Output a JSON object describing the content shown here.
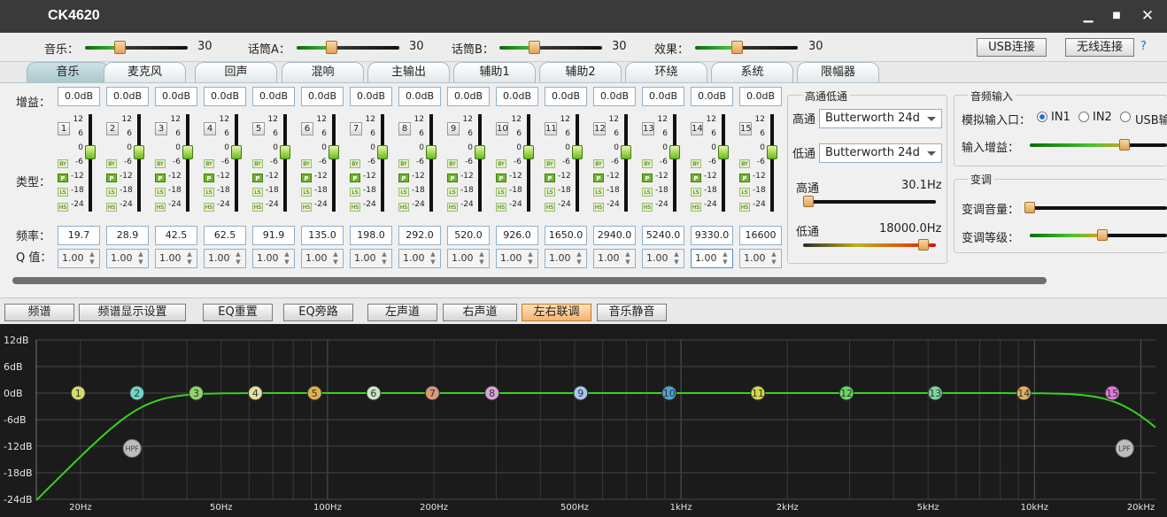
{
  "title": "CK4620",
  "window": {
    "minimize": "▁",
    "maximize": "■",
    "close": "✕"
  },
  "volumes": [
    {
      "label": "音乐：",
      "value": "30"
    },
    {
      "label": "话筒A：",
      "value": "30"
    },
    {
      "label": "话筒B：",
      "value": "30"
    },
    {
      "label": "效果：",
      "value": "30"
    }
  ],
  "buttons": {
    "usb": "USB连接",
    "wireless": "无线连接",
    "help": "?"
  },
  "tabs": [
    "音乐",
    "麦克风",
    "回声",
    "混响",
    "主输出",
    "辅助1",
    "辅助2",
    "环绕",
    "系统",
    "限幅器"
  ],
  "active_tab": 0,
  "labels": {
    "gain": "增益：",
    "type": "类型：",
    "freq": "频率：",
    "q": "Q 值："
  },
  "scale": [
    "12",
    "6",
    "0",
    "-6",
    "-12",
    "-18",
    "-24"
  ],
  "badges": [
    "BY",
    "P",
    "LS",
    "HS"
  ],
  "channels": [
    {
      "num": "1",
      "gain": "0.0dB",
      "freq": "19.7",
      "q": "1.00"
    },
    {
      "num": "2",
      "gain": "0.0dB",
      "freq": "28.9",
      "q": "1.00"
    },
    {
      "num": "3",
      "gain": "0.0dB",
      "freq": "42.5",
      "q": "1.00"
    },
    {
      "num": "4",
      "gain": "0.0dB",
      "freq": "62.5",
      "q": "1.00"
    },
    {
      "num": "5",
      "gain": "0.0dB",
      "freq": "91.9",
      "q": "1.00"
    },
    {
      "num": "6",
      "gain": "0.0dB",
      "freq": "135.0",
      "q": "1.00"
    },
    {
      "num": "7",
      "gain": "0.0dB",
      "freq": "198.0",
      "q": "1.00"
    },
    {
      "num": "8",
      "gain": "0.0dB",
      "freq": "292.0",
      "q": "1.00"
    },
    {
      "num": "9",
      "gain": "0.0dB",
      "freq": "520.0",
      "q": "1.00"
    },
    {
      "num": "10",
      "gain": "0.0dB",
      "freq": "926.0",
      "q": "1.00"
    },
    {
      "num": "11",
      "gain": "0.0dB",
      "freq": "1650.0",
      "q": "1.00"
    },
    {
      "num": "12",
      "gain": "0.0dB",
      "freq": "2940.0",
      "q": "1.00"
    },
    {
      "num": "13",
      "gain": "0.0dB",
      "freq": "5240.0",
      "q": "1.00"
    },
    {
      "num": "14",
      "gain": "0.0dB",
      "freq": "9330.0",
      "q": "1.00"
    },
    {
      "num": "15",
      "gain": "0.0dB",
      "freq": "16600",
      "q": "1.00"
    }
  ],
  "selected_q_channel": 13,
  "hplp": {
    "title": "高通低通",
    "hp_label": "高通",
    "hp_type": "Butterworth 24d",
    "lp_label": "低通",
    "lp_type": "Butterworth 24d",
    "hp_slider_label": "高通",
    "hp_value": "30.1Hz",
    "lp_slider_label": "低通",
    "lp_value": "18000.0Hz"
  },
  "audio_input": {
    "title": "音频输入",
    "port_label": "模拟输入口：",
    "options": [
      "IN1",
      "IN2",
      "USB输"
    ],
    "selected": 0,
    "gain_label": "输入增益："
  },
  "pitch": {
    "title": "变调",
    "volume_label": "变调音量：",
    "level_label": "变调等级："
  },
  "toolbar": [
    "频谱",
    "频谱显示设置",
    "EQ重置",
    "EQ旁路",
    "左声道",
    "右声道",
    "左右联调",
    "音乐静音"
  ],
  "toolbar_active": 6,
  "graph": {
    "y_labels": [
      "12dB",
      "6dB",
      "0dB",
      "-6dB",
      "-12dB",
      "-18dB",
      "-24dB"
    ],
    "x_labels": [
      "20Hz",
      "50Hz",
      "100Hz",
      "200Hz",
      "500Hz",
      "1kHz",
      "2kHz",
      "5kHz",
      "10kHz",
      "20kHz"
    ],
    "hpf_label": "HPF",
    "lpf_label": "LPF",
    "curve_color": "#39d21f",
    "point_colors": [
      "#d9d96a",
      "#6fd6c4",
      "#8fd66a",
      "#e2e0a0",
      "#e0b050",
      "#c9e6c9",
      "#d89a7a",
      "#d8a6d6",
      "#a9c6ef",
      "#4aa6d6",
      "#d8d84a",
      "#6ad66a",
      "#7ad69a",
      "#e0b060",
      "#e07ad8"
    ]
  }
}
